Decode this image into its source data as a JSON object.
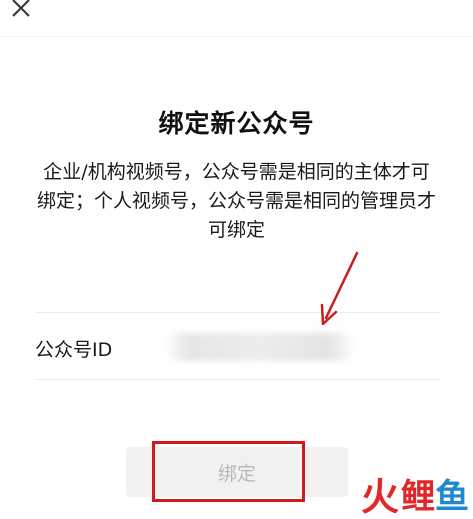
{
  "header": {
    "close_icon": "close-icon"
  },
  "dialog": {
    "title": "绑定新公众号",
    "description": "企业/机构视频号，公众号需是相同的主体才可绑定；个人视频号，公众号需是相同的管理员才可绑定",
    "id_row": {
      "label": "公众号ID",
      "value_state": "blurred"
    },
    "bind_button": {
      "label": "绑定",
      "state": "disabled"
    }
  },
  "annotations": {
    "highlight_color": "#d11a1a",
    "arrow_color": "#c81e1e"
  },
  "watermark": {
    "chars": [
      "火",
      "鲤",
      "鱼"
    ],
    "colors": [
      "#e2262a",
      "#e2262a",
      "#1e88d2"
    ]
  }
}
